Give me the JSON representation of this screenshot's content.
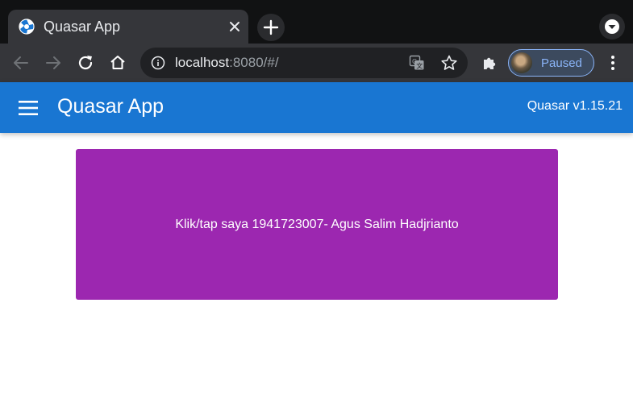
{
  "browser": {
    "tab_title": "Quasar App",
    "url_host": "localhost",
    "url_rest": ":8080/#/",
    "profile_status": "Paused",
    "icons": [
      "quasar-favicon-icon",
      "close-icon",
      "plus-icon",
      "chevron-down-icon",
      "back-arrow-icon",
      "forward-arrow-icon",
      "reload-icon",
      "home-icon",
      "info-icon",
      "translate-icon",
      "star-icon",
      "puzzle-icon",
      "avatar",
      "more-vert-icon"
    ]
  },
  "app": {
    "title": "Quasar App",
    "version": "Quasar v1.15.21",
    "header_color": "#1976d2",
    "menu_icon": "menu-icon"
  },
  "main": {
    "card_text": "Klik/tap saya 1941723007- Agus Salim Hadjrianto",
    "card_color": "#9c27b0"
  }
}
